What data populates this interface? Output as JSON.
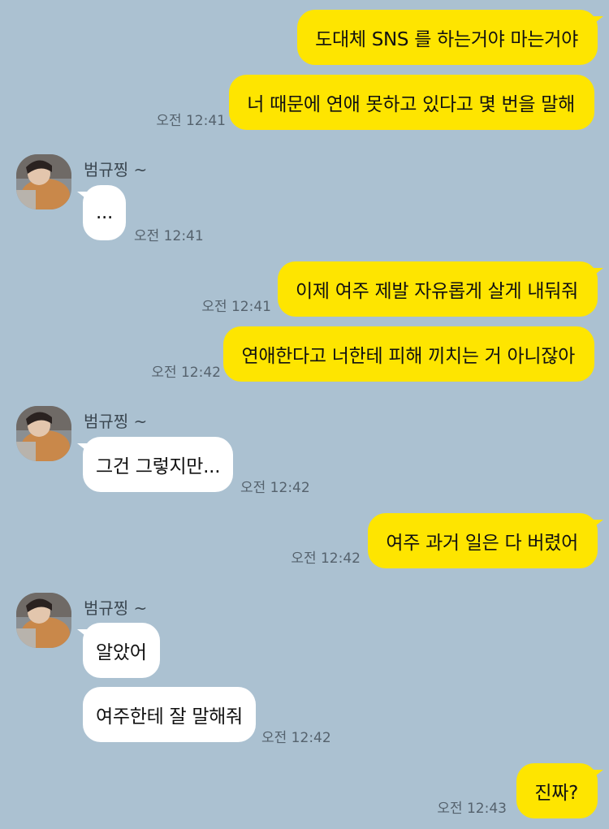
{
  "chat": {
    "sender_name": "범규찡 ~",
    "messages": [
      {
        "from": "me",
        "text": "도대체 SNS 를 하는거야 마는거야",
        "time": ""
      },
      {
        "from": "me",
        "text": "너 때문에 연애 못하고 있다고 몇 번을 말해",
        "time": "오전 12:41"
      },
      {
        "from": "other",
        "text": "...",
        "time": "오전 12:41"
      },
      {
        "from": "me",
        "text": "이제 여주 제발 자유롭게 살게 내둬줘",
        "time": "오전 12:41"
      },
      {
        "from": "me",
        "text": "연애한다고 너한테 피해 끼치는 거 아니잖아",
        "time": "오전 12:42"
      },
      {
        "from": "other",
        "text": "그건 그렇지만...",
        "time": "오전 12:42"
      },
      {
        "from": "me",
        "text": "여주 과거 일은 다 버렸어",
        "time": "오전 12:42"
      },
      {
        "from": "other",
        "text": "알았어",
        "time": ""
      },
      {
        "from": "other",
        "text": "여주한테 잘 말해줘",
        "time": "오전 12:42"
      },
      {
        "from": "me",
        "text": "진짜?",
        "time": "오전 12:43"
      }
    ]
  },
  "colors": {
    "background": "#abc1d1",
    "my_bubble": "#fee500",
    "their_bubble": "#ffffff",
    "timestamp": "#55626d"
  },
  "icons": {
    "avatar": "profile-photo"
  }
}
